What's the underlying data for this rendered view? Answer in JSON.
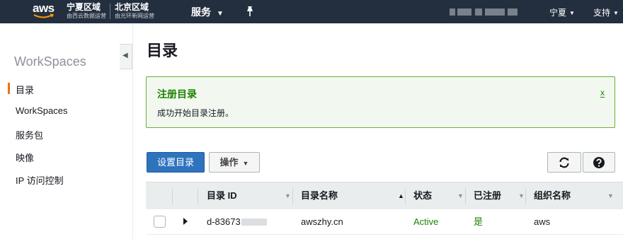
{
  "topnav": {
    "logo_text": "aws",
    "region_ningxia_name": "宁夏区域",
    "region_ningxia_operator": "由西云数据运营",
    "region_beijing_name": "北京区域",
    "region_beijing_operator": "由光环新网运营",
    "services_label": "服务",
    "region_menu_label": "宁夏",
    "support_label": "支持"
  },
  "sidebar": {
    "title": "WorkSpaces",
    "items": [
      {
        "label": "目录",
        "active": true
      },
      {
        "label": "WorkSpaces",
        "active": false
      },
      {
        "label": "服务包",
        "active": false
      },
      {
        "label": "映像",
        "active": false
      },
      {
        "label": "IP 访问控制",
        "active": false
      }
    ]
  },
  "main": {
    "page_title": "目录",
    "flash": {
      "title": "注册目录",
      "message": "成功开始目录注册。",
      "close": "x"
    },
    "toolbar": {
      "setup_label": "设置目录",
      "actions_label": "操作"
    },
    "table": {
      "columns": [
        "目录 ID",
        "目录名称",
        "状态",
        "已注册",
        "组织名称"
      ],
      "rows": [
        {
          "directory_id_prefix": "d-83673",
          "directory_name": "awszhy.cn",
          "status": "Active",
          "registered": "是",
          "organization": "aws"
        }
      ]
    }
  },
  "colors": {
    "nav_bg": "#232f3e",
    "accent_orange": "#ec7211",
    "primary_blue": "#2f73bd",
    "success_green": "#1d8102"
  }
}
